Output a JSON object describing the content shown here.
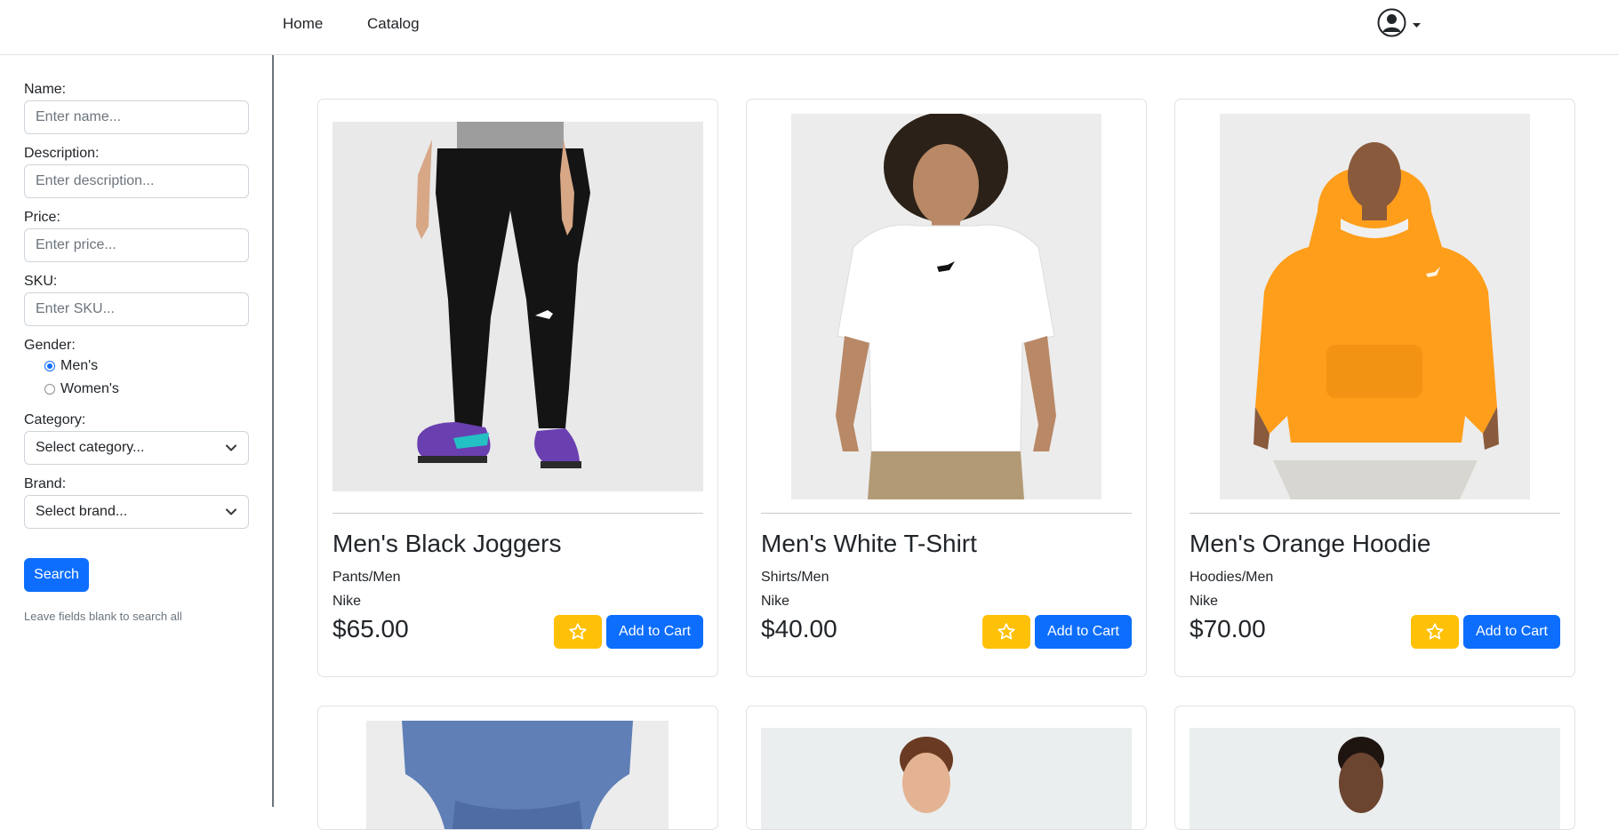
{
  "nav": {
    "home": "Home",
    "catalog": "Catalog"
  },
  "filters": {
    "name": {
      "label": "Name:",
      "placeholder": "Enter name..."
    },
    "description": {
      "label": "Description:",
      "placeholder": "Enter description..."
    },
    "price": {
      "label": "Price:",
      "placeholder": "Enter price..."
    },
    "sku": {
      "label": "SKU:",
      "placeholder": "Enter SKU..."
    },
    "gender": {
      "label": "Gender:",
      "options": [
        "Men's",
        "Women's"
      ],
      "selected": "Men's"
    },
    "category": {
      "label": "Category:",
      "value": "Select category..."
    },
    "brand": {
      "label": "Brand:",
      "value": "Select brand..."
    },
    "search_label": "Search",
    "hint": "Leave fields blank to search all"
  },
  "products": [
    {
      "name": "Men's Black Joggers",
      "category": "Pants/Men",
      "brand": "Nike",
      "price": "$65.00",
      "add_label": "Add to Cart"
    },
    {
      "name": "Men's White T-Shirt",
      "category": "Shirts/Men",
      "brand": "Nike",
      "price": "$40.00",
      "add_label": "Add to Cart"
    },
    {
      "name": "Men's Orange Hoodie",
      "category": "Hoodies/Men",
      "brand": "Nike",
      "price": "$70.00",
      "add_label": "Add to Cart"
    }
  ],
  "colors": {
    "primary": "#0d6efd",
    "favorite": "#ffc107",
    "border": "#dee2e6"
  },
  "icons": {
    "account": "user-circle-icon",
    "favorite": "star-outline-icon",
    "dropdown": "chevron-down-icon"
  }
}
